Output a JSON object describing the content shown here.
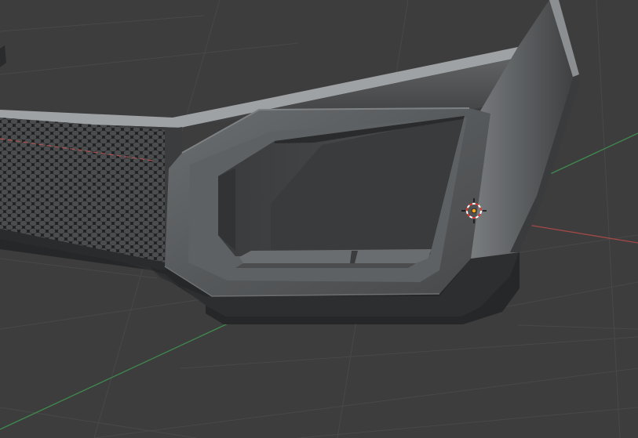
{
  "viewport": {
    "background_color": "#3d3d3d",
    "grid_color": "#4a4a4a",
    "x_axis_color": "#a34848",
    "y_axis_color": "#3f8a4f",
    "shading": "solid"
  },
  "scene": {
    "objects": [
      {
        "name": "front-bumper",
        "material_color": "#5a5c5d"
      },
      {
        "name": "honeycomb-grille",
        "material_color": "#2b2c2d"
      },
      {
        "name": "fog-light-housing",
        "material_color": "#54575a"
      }
    ]
  },
  "cursor_3d": {
    "icon": "3d-cursor-icon",
    "ring_color_a": "#e23a2e",
    "ring_color_b": "#ffffff",
    "origin_color": "#f5a623"
  }
}
